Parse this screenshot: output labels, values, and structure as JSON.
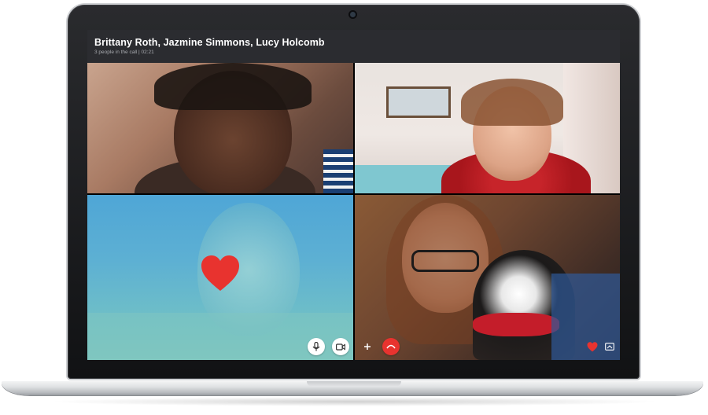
{
  "call": {
    "title": "Brittany Roth, Jazmine Simmons, Lucy Holcomb",
    "subtitle": "3 people in the call | 02:21"
  },
  "controls": {
    "mic_icon": "microphone-icon",
    "video_icon": "video-camera-icon",
    "add_icon": "plus-icon",
    "hangup_icon": "hang-up-icon",
    "react_icon": "heart-icon",
    "share_icon": "screen-share-icon"
  },
  "colors": {
    "header_bg": "#2b2c30",
    "hangup_red": "#e8332f",
    "heart_red": "#e8332f"
  }
}
